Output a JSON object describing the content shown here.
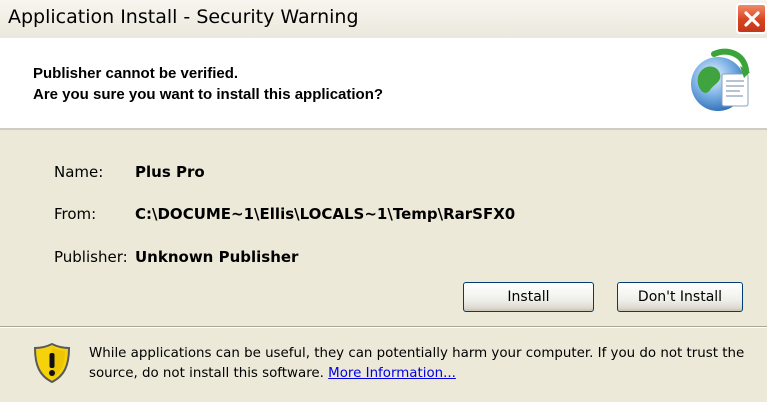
{
  "window": {
    "title": "Application Install - Security Warning",
    "close_glyph": "✕"
  },
  "header": {
    "line1": "Publisher cannot be verified.",
    "line2": "Are you sure you want to install this application?",
    "icon": "globe-install-icon"
  },
  "details": {
    "name_label": "Name:",
    "name_value": "Plus Pro",
    "from_label": "From:",
    "from_value": "C:\\DOCUME~1\\Ellis\\LOCALS~1\\Temp\\RarSFX0",
    "publisher_label": "Publisher:",
    "publisher_value": "Unknown Publisher"
  },
  "buttons": {
    "install": "Install",
    "dont_install": "Don't Install"
  },
  "warning": {
    "icon": "shield-warning-icon",
    "text": "While applications can be useful, they can potentially harm your computer. If you do not trust the source, do not install this software.",
    "link": "More Information..."
  },
  "colors": {
    "panel": "#ece9d8",
    "close_red": "#d8431f",
    "link": "#0000e0",
    "shield_yellow": "#f5d20a"
  }
}
